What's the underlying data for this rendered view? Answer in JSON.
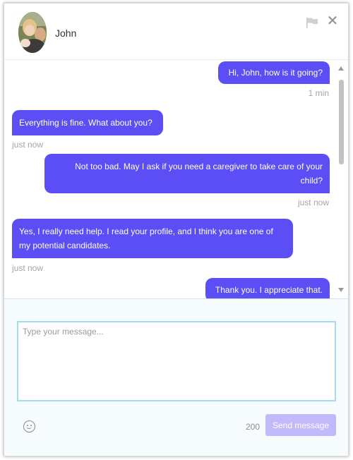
{
  "header": {
    "contact_name": "John"
  },
  "messages": [
    {
      "direction": "outgoing",
      "text": "Hi, John, how is it going?",
      "time": "1 min"
    },
    {
      "direction": "incoming",
      "text": "Everything is fine. What about you?",
      "time": "just now"
    },
    {
      "direction": "outgoing",
      "text": "Not too bad. May I ask if you need a caregiver to take care of your child?",
      "time": "just now"
    },
    {
      "direction": "incoming",
      "text": "Yes, I really need help. I read your profile, and I think you are one of my potential candidates.",
      "time": "just now"
    },
    {
      "direction": "outgoing",
      "text": "Thank you. I appreciate that."
    }
  ],
  "composer": {
    "placeholder": "Type your message...",
    "char_count": "200",
    "send_label": "Send message"
  },
  "icons": {
    "flag": "flag-icon",
    "close": "close-icon",
    "emoji": "emoji-icon",
    "close_glyph": "✕"
  },
  "colors": {
    "bubble": "#5b4ef5",
    "send_disabled": "#c2b9fb",
    "input_border": "#a8dbec"
  }
}
